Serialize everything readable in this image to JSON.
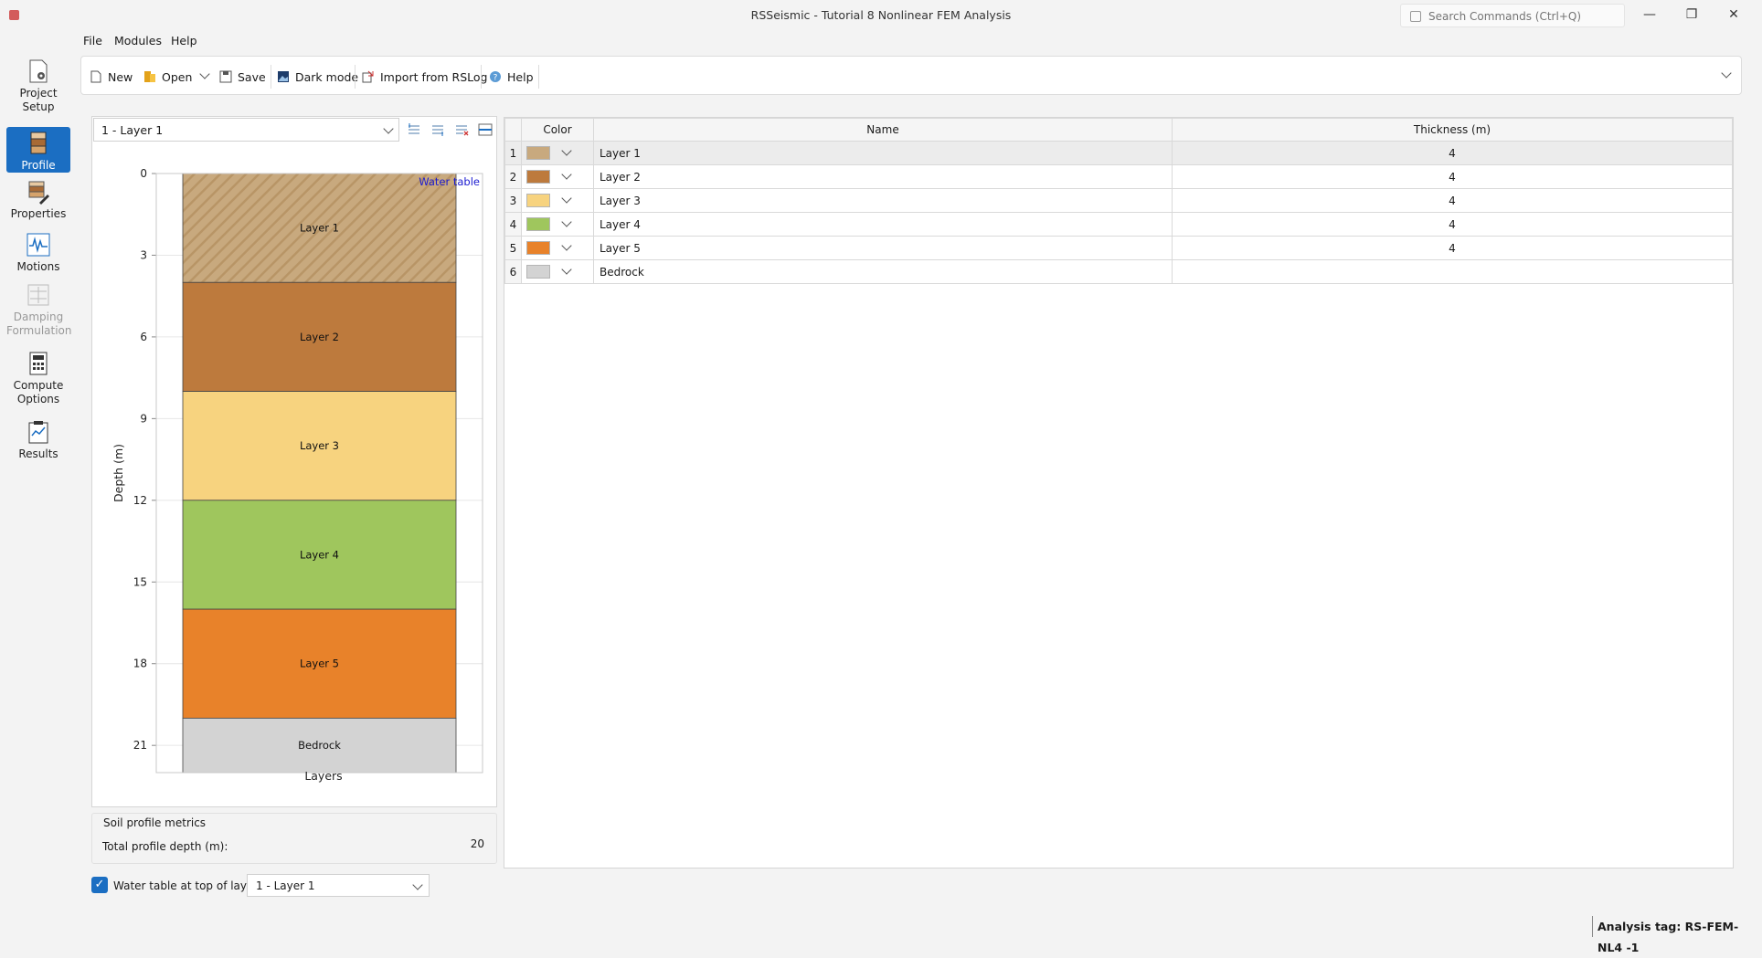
{
  "window": {
    "title": "RSSeismic - Tutorial 8 Nonlinear FEM Analysis",
    "search_placeholder": "Search Commands (Ctrl+Q)",
    "minimize": "—",
    "maximize": "❐",
    "close": "✕"
  },
  "sidebar": {
    "items": [
      {
        "label": "Project Setup",
        "icon": "project-setup-icon",
        "active": false,
        "disabled": false
      },
      {
        "label": "Profile",
        "icon": "profile-icon",
        "active": true,
        "disabled": false
      },
      {
        "label": "Properties",
        "icon": "properties-icon",
        "active": false,
        "disabled": false
      },
      {
        "label": "Motions",
        "icon": "motions-icon",
        "active": false,
        "disabled": false
      },
      {
        "label": "Damping Formulation",
        "icon": "damping-icon",
        "active": false,
        "disabled": true
      },
      {
        "label": "Compute Options",
        "icon": "compute-icon",
        "active": false,
        "disabled": false
      },
      {
        "label": "Results",
        "icon": "results-icon",
        "active": false,
        "disabled": false
      }
    ]
  },
  "menu": {
    "file": "File",
    "modules": "Modules",
    "help": "Help"
  },
  "toolbar": {
    "new": "New",
    "open": "Open",
    "save": "Save",
    "dark_mode": "Dark mode",
    "import": "Import from RSLog",
    "help": "Help"
  },
  "layer_select": {
    "value": "1 - Layer 1"
  },
  "chart_data": {
    "type": "bar",
    "orientation": "stacked-vertical-depth",
    "xlabel": "Layers",
    "ylabel": "Depth (m)",
    "yticks": [
      "0",
      "3",
      "6",
      "9",
      "12",
      "15",
      "18",
      "21"
    ],
    "ylim": [
      0,
      22
    ],
    "annotation": "Water table",
    "layers": [
      {
        "name": "Layer 1",
        "top": 0,
        "bottom": 4,
        "color": "#c8a97e",
        "hatched": true
      },
      {
        "name": "Layer 2",
        "top": 4,
        "bottom": 8,
        "color": "#bd7a3d",
        "hatched": false
      },
      {
        "name": "Layer 3",
        "top": 8,
        "bottom": 12,
        "color": "#f7d37f",
        "hatched": false
      },
      {
        "name": "Layer 4",
        "top": 12,
        "bottom": 16,
        "color": "#9fc65d",
        "hatched": false
      },
      {
        "name": "Layer 5",
        "top": 16,
        "bottom": 20,
        "color": "#e8822a",
        "hatched": false
      },
      {
        "name": "Bedrock",
        "top": 20,
        "bottom": 22,
        "color": "#d3d3d3",
        "hatched": false
      }
    ]
  },
  "metrics": {
    "title": "Soil profile metrics",
    "total_depth_label": "Total profile depth (m):",
    "total_depth_value": "20"
  },
  "water_table": {
    "checked": true,
    "label": "Water table at top of layer:",
    "value": "1 - Layer 1"
  },
  "grid": {
    "headers": {
      "color": "Color",
      "name": "Name",
      "thickness": "Thickness (m)"
    },
    "rows": [
      {
        "num": "1",
        "color": "#c8a97e",
        "name": "Layer 1",
        "thickness": "4"
      },
      {
        "num": "2",
        "color": "#bd7a3d",
        "name": "Layer 2",
        "thickness": "4"
      },
      {
        "num": "3",
        "color": "#f7d37f",
        "name": "Layer 3",
        "thickness": "4"
      },
      {
        "num": "4",
        "color": "#9fc65d",
        "name": "Layer 4",
        "thickness": "4"
      },
      {
        "num": "5",
        "color": "#e8822a",
        "name": "Layer 5",
        "thickness": "4"
      },
      {
        "num": "6",
        "color": "#d3d3d3",
        "name": "Bedrock",
        "thickness": ""
      }
    ]
  },
  "status": {
    "analysis_tag": "Analysis tag: RS-FEM-NL4 -1"
  }
}
